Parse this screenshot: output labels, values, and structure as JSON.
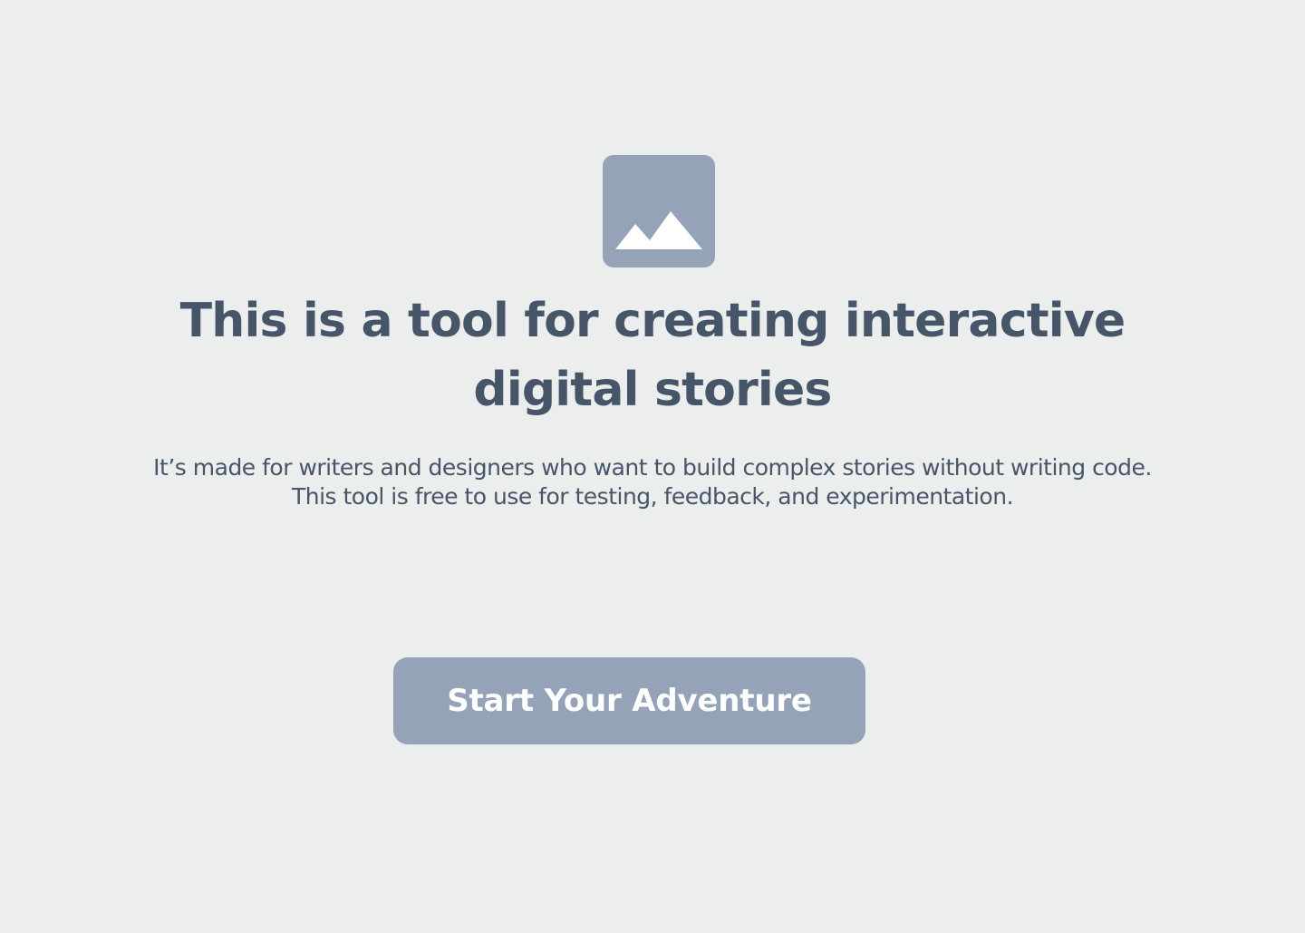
{
  "hero": {
    "image_icon": "mountain-image-placeholder-icon",
    "image_color": "#94a3b8",
    "headline": "This is a tool for creating interactive digital stories",
    "description": "It’s made for writers and designers who want to build complex stories without writing code. This tool is free to use for testing, feedback, and experimentation."
  },
  "cta": {
    "label": "Start Your Adventure",
    "background_color": "#94a3b8",
    "text_color": "#ffffff"
  },
  "theme": {
    "background_color": "#eceeee",
    "text_color": "#475569"
  }
}
